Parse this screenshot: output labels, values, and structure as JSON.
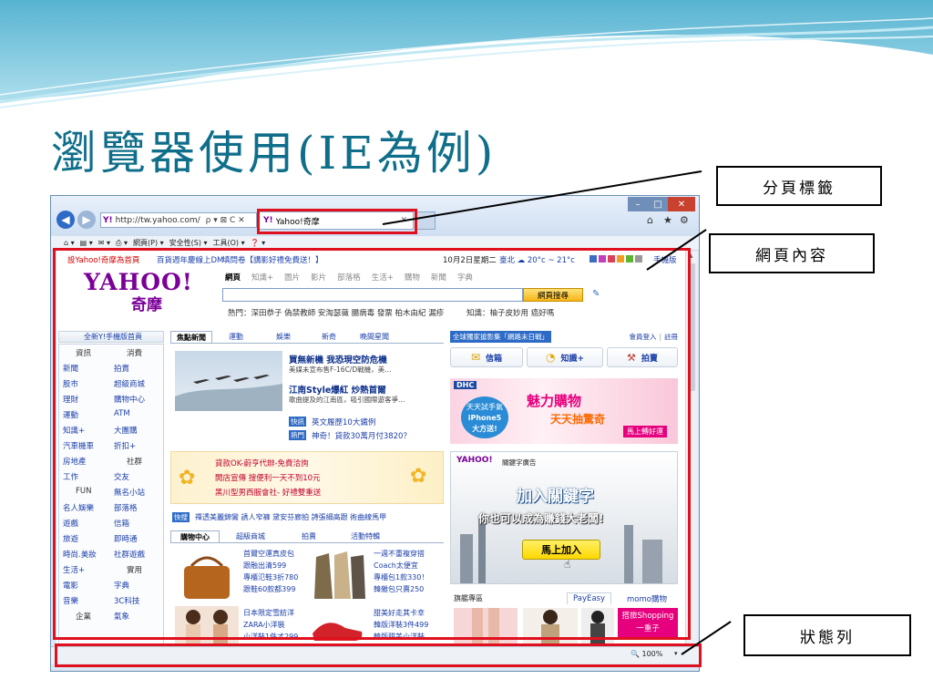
{
  "slide": {
    "title": "瀏覽器使用(IE為例)",
    "callouts": {
      "tab": "分頁標籤",
      "content": "網頁內容",
      "status": "狀態列"
    }
  },
  "browser": {
    "address": "http://tw.yahoo.com/",
    "address_suffix": "ρ ▾ ⊠ C ✕",
    "tab_title": "Yahoo!奇摩",
    "window_buttons": [
      "–",
      "□",
      "✕"
    ],
    "command_bar": [
      "網頁(P) ▾",
      "安全性(S) ▾",
      "工具(O) ▾",
      "❓ ▾"
    ],
    "status_zoom": "🔍 100%"
  },
  "yahoo": {
    "top_links": [
      "設Yahoo!奇摩為首頁",
      "百貨週年慶線上DM",
      "填問卷【講影好禮免費送！】"
    ],
    "date": "10月2日星期二",
    "weather": "臺北 ☁ 20°c ~ 21°c",
    "mobile_link": "手機版",
    "logo_text": "YAHOO!",
    "logo_sub": "奇摩",
    "search_tabs": [
      "網頁",
      "知識+",
      "圖片",
      "影片",
      "部落格",
      "生活+",
      "購物",
      "新聞",
      "字典"
    ],
    "search_button": "網頁搜尋",
    "hot_label": "熱門：深田恭子 偽禁教師 安淘瑟薇 腸病毒 發票 柏木由紀 漏疹",
    "knowledge_label": "知識：柚子皮妙用 癌好嗎",
    "sidebar_header": "全新Y!手機版首頁",
    "sidebar": [
      [
        "資訊",
        "消費"
      ],
      [
        "新聞",
        "拍賣"
      ],
      [
        "股市",
        "超級商城"
      ],
      [
        "理財",
        "購物中心"
      ],
      [
        "運動",
        "ATM"
      ],
      [
        "知識+",
        "大團購"
      ],
      [
        "汽車機車",
        "折扣+"
      ],
      [
        "房地產",
        "社群"
      ],
      [
        "工作",
        "交友"
      ],
      [
        "FUN",
        "無名小站"
      ],
      [
        "名人娛樂",
        "部落格"
      ],
      [
        "遊戲",
        "信箱"
      ],
      [
        "旅遊",
        "即時通"
      ],
      [
        "時尚.美妝",
        "社群遊戲"
      ],
      [
        "生活+",
        "實用"
      ],
      [
        "電影",
        "字典"
      ],
      [
        "音樂",
        "3C科技"
      ],
      [
        "企業",
        "氣象"
      ]
    ],
    "news_tabs": [
      "焦點新聞",
      "運動",
      "娛樂",
      "新奇",
      "晚間星聞"
    ],
    "news_items": [
      {
        "title": "買無新機 我恐現空防危機",
        "desc": "美媒未宣布售F-16C/D戰機，美…"
      },
      {
        "title": "江南Style爆紅 炒熱首爾",
        "desc": "歌曲提及的江南區，吸引國際遊客爭…"
      }
    ],
    "news_short": [
      {
        "badge": "快訊",
        "text": "英文履歷10大鐵例"
      },
      {
        "badge": "熱門",
        "text": "神奇！貸款30萬月付3820？"
      }
    ],
    "ads": [
      "貸款OK-蔚亨代辦-免費洽詢",
      "開店宣傳 搜便利一天不到10元",
      "黑川型男西服會社- 好禮雙重送"
    ],
    "quick_label": "快搜",
    "quick_text": "禪透美麗錦鸞 誘人窄褲 黛安芬廊拍 詩張細高跟 術曲線馬甲",
    "shop_tabs": [
      "購物中心",
      "超級商城",
      "拍賣",
      "活動特輯"
    ],
    "shop_items": [
      [
        "首爾空運真皮包",
        "跟融出清599",
        "專櫃氾鞋3折780",
        "跟鞋60款都399"
      ],
      [
        "一週不重複穿搭",
        "Coach太便宜",
        "專櫃包1款330！",
        "韓雜包只賣250"
      ],
      [
        "日本限定雪紡洋",
        "ZARA小洋裝",
        "小洋裝1件才299"
      ],
      [
        "甜美好走其卡幸",
        "韓版洋裝3件499",
        "韓版甜美小洋裝"
      ]
    ],
    "right_header": "全球獨家搶影集「網路末日戰」",
    "member_links": [
      "會員登入",
      "註冊"
    ],
    "service_buttons": [
      "信箱",
      "知識+",
      "拍賣"
    ],
    "ad_dhc": {
      "brand": "DHC",
      "l1": "天天試手氣",
      "l2": "iPhone5",
      "l3": "大方送!",
      "slogan": "魅力購物",
      "slogan2": "天天抽驚奇",
      "cta": "馬上轉好運"
    },
    "ad_keyword": {
      "header": "關鍵字廣告",
      "line1": "加入關鍵字",
      "line2": "你也可以成為賺錢大老闆!",
      "button": "馬上加入"
    },
    "flagship_label": "旗艦專區",
    "flagship_tabs": [
      "PayEasy",
      "momo購物"
    ],
    "shopping_banner": [
      "搭旅Shopping",
      "一重子"
    ]
  },
  "colors": {
    "title_blue": "#0f6e8a",
    "yahoo_purple": "#7b0099",
    "callout_red": "#e0101e"
  }
}
